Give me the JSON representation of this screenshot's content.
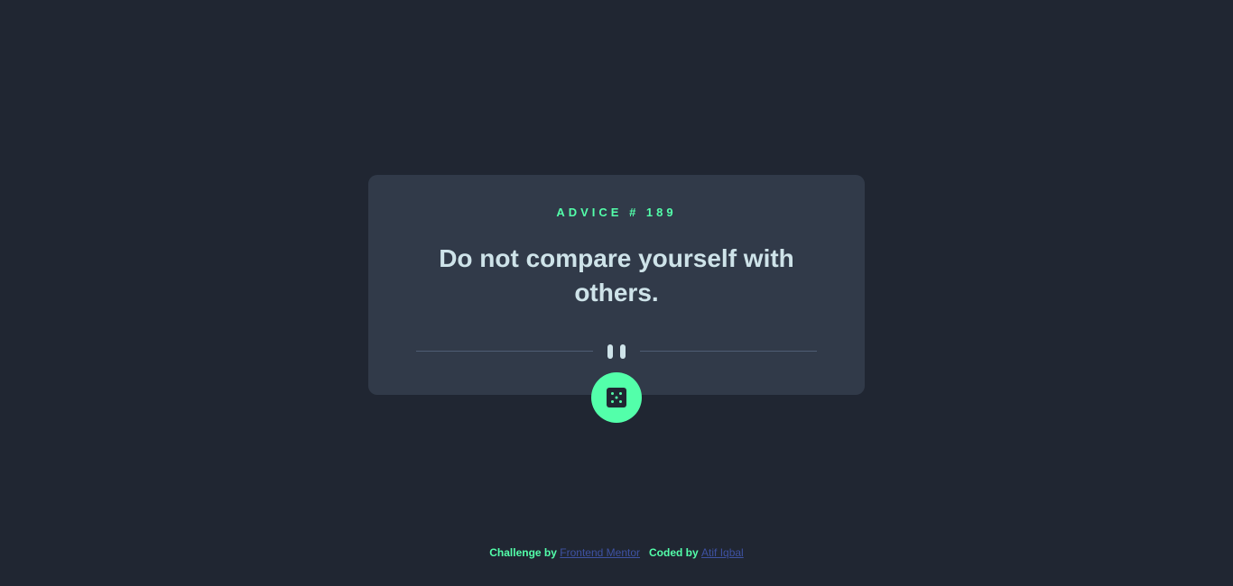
{
  "card": {
    "advice_id": "ADVICE # 189",
    "quote": "Do not compare yourself with others."
  },
  "dice_button": {
    "icon": "dice-icon"
  },
  "attribution": {
    "challenge_prefix": "Challenge by",
    "challenge_link": "Frontend Mentor",
    "coded_prefix": "Coded by",
    "coded_link": "Atif Iqbal"
  },
  "colors": {
    "background": "#202632",
    "card": "#313a49",
    "accent": "#53ffaa",
    "text": "#cee3e9",
    "link": "#3e52a3"
  }
}
